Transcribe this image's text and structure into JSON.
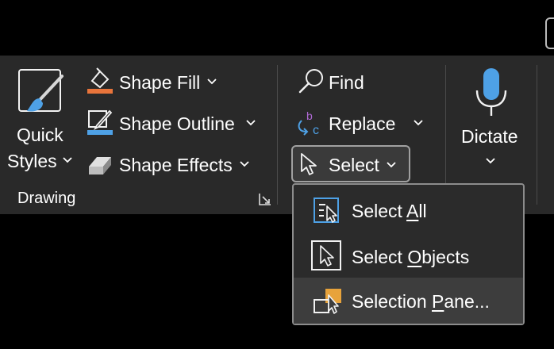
{
  "ribbon": {
    "drawing_group": {
      "quick_styles_line1": "Quick",
      "quick_styles_line2": "Styles",
      "shape_fill": "Shape Fill",
      "shape_outline": "Shape Outline",
      "shape_effects": "Shape Effects",
      "group_label": "Drawing"
    },
    "editing_group": {
      "find": "Find",
      "replace": "Replace",
      "select": "Select"
    },
    "voice_group": {
      "dictate": "Dictate"
    }
  },
  "select_menu": {
    "items": [
      {
        "before": "Select ",
        "key": "A",
        "after": "ll"
      },
      {
        "before": "Select ",
        "key": "O",
        "after": "bjects"
      },
      {
        "before": "Selection ",
        "key": "P",
        "after": "ane..."
      }
    ]
  },
  "colors": {
    "ribbon_bg": "#292929",
    "accent_blue": "#4ea1e6",
    "accent_orange": "#e8743b",
    "accent_purple": "#b06ad6"
  }
}
